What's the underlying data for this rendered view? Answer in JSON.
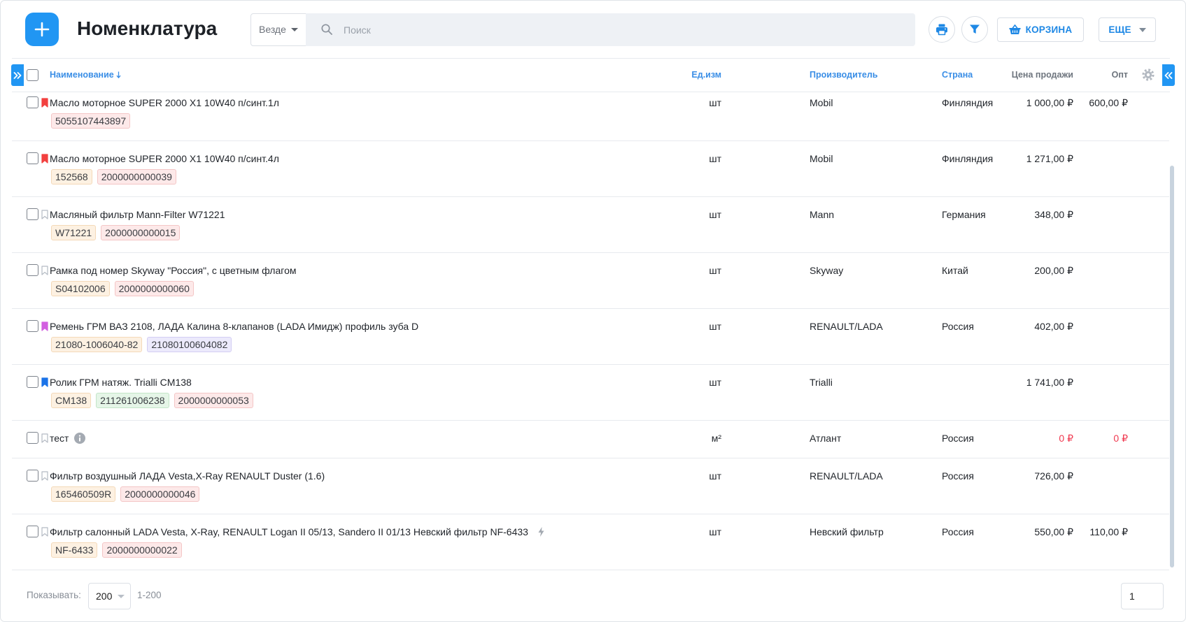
{
  "colors": {
    "accent": "#2196f3",
    "link": "#1e88e5",
    "zero_price": "#f0384f"
  },
  "header": {
    "title": "Номенклатура",
    "scope": "Везде",
    "search": {
      "placeholder": "Поиск",
      "value": ""
    },
    "cart_label": "КОРЗИНА",
    "more_label": "ЕЩЕ",
    "icons": {
      "add": "plus-icon",
      "search": "search-icon",
      "print": "printer-icon",
      "filter": "filter-icon",
      "cart": "basket-icon"
    }
  },
  "table": {
    "columns": {
      "name": "Наименование",
      "unit": "Ед.изм",
      "manufacturer": "Производитель",
      "country": "Страна",
      "price": "Цена продажи",
      "opt": "Опт"
    },
    "icons": {
      "sort": "sort-arrow-down-icon",
      "settings": "gear-icon",
      "expand_left": "double-chevron-right-icon",
      "collapse_right": "double-chevron-left-icon"
    },
    "tag_tones": {
      "beige": {
        "bg": "#fdf1e2",
        "border": "#f4d9b8"
      },
      "pink": {
        "bg": "#fde9e9",
        "border": "#f4c6c6"
      },
      "lavender": {
        "bg": "#eceafc",
        "border": "#d3cdf3"
      },
      "green": {
        "bg": "#e5f5e7",
        "border": "#c3e5c8"
      }
    },
    "rows": [
      {
        "name": "Масло моторное SUPER 2000 X1 10W40 п/синт.1л",
        "bookmark_color": "#f2403f",
        "tags": [
          {
            "text": "5055107443897",
            "tone": "pink"
          }
        ],
        "unit": "шт",
        "manufacturer": "Mobil",
        "country": "Финляндия",
        "price": "1 000,00 ₽",
        "opt": "600,00 ₽"
      },
      {
        "name": "Масло моторное SUPER 2000 X1 10W40 п/синт.4л",
        "bookmark_color": "#f2403f",
        "tags": [
          {
            "text": "152568",
            "tone": "beige"
          },
          {
            "text": "2000000000039",
            "tone": "pink"
          }
        ],
        "unit": "шт",
        "manufacturer": "Mobil",
        "country": "Финляндия",
        "price": "1 271,00 ₽",
        "opt": ""
      },
      {
        "name": "Масляный фильтр Mann-Filter W71221",
        "bookmark_color": null,
        "tags": [
          {
            "text": "W71221",
            "tone": "beige"
          },
          {
            "text": "2000000000015",
            "tone": "pink"
          }
        ],
        "unit": "шт",
        "manufacturer": "Mann",
        "country": "Германия",
        "price": "348,00 ₽",
        "opt": ""
      },
      {
        "name": "Рамка под номер Skyway \"Россия\", с цветным флагом",
        "bookmark_color": null,
        "tags": [
          {
            "text": "S04102006",
            "tone": "beige"
          },
          {
            "text": "2000000000060",
            "tone": "pink"
          }
        ],
        "unit": "шт",
        "manufacturer": "Skyway",
        "country": "Китай",
        "price": "200,00 ₽",
        "opt": ""
      },
      {
        "name": "Ремень ГРМ ВАЗ 2108, ЛАДА Калина 8-клапанов (LADA Имидж) профиль зуба D",
        "bookmark_color": "#d25fe0",
        "tags": [
          {
            "text": "21080-1006040-82",
            "tone": "beige"
          },
          {
            "text": "21080100604082",
            "tone": "lavender"
          }
        ],
        "unit": "шт",
        "manufacturer": "RENAULT/LADA",
        "country": "Россия",
        "price": "402,00 ₽",
        "opt": ""
      },
      {
        "name": "Ролик ГРМ натяж. Trialli CM138",
        "bookmark_color": "#1a73e8",
        "tags": [
          {
            "text": "CM138",
            "tone": "beige"
          },
          {
            "text": "211261006238",
            "tone": "green"
          },
          {
            "text": "2000000000053",
            "tone": "pink"
          }
        ],
        "unit": "шт",
        "manufacturer": "Trialli",
        "country": "",
        "price": "1 741,00 ₽",
        "opt": ""
      },
      {
        "name": "тест",
        "bookmark_color": null,
        "info_icon": "info-icon",
        "tags": [],
        "unit": "м²",
        "manufacturer": "Атлант",
        "country": "Россия",
        "price": "0 ₽",
        "opt": "0 ₽",
        "price_color": "#f0384f"
      },
      {
        "name": "Фильтр воздушный ЛАДА Vesta,X-Ray RENAULT Duster (1.6)",
        "bookmark_color": null,
        "tags": [
          {
            "text": "165460509R",
            "tone": "beige"
          },
          {
            "text": "2000000000046",
            "tone": "pink"
          }
        ],
        "unit": "шт",
        "manufacturer": "RENAULT/LADA",
        "country": "Россия",
        "price": "726,00 ₽",
        "opt": ""
      },
      {
        "name": "Фильтр салонный LADA Vesta, X-Ray, RENAULT Logan II 05/13, Sandero II 01/13 Невский фильтр NF-6433",
        "bookmark_color": null,
        "flash_icon": "lightning-icon",
        "tags": [
          {
            "text": "NF-6433",
            "tone": "beige"
          },
          {
            "text": "2000000000022",
            "tone": "pink"
          }
        ],
        "unit": "шт",
        "manufacturer": "Невский фильтр",
        "country": "Россия",
        "price": "550,00 ₽",
        "opt": "110,00 ₽"
      }
    ]
  },
  "footer": {
    "show_label": "Показывать:",
    "page_size": "200",
    "range": "1-200",
    "page": "1"
  }
}
